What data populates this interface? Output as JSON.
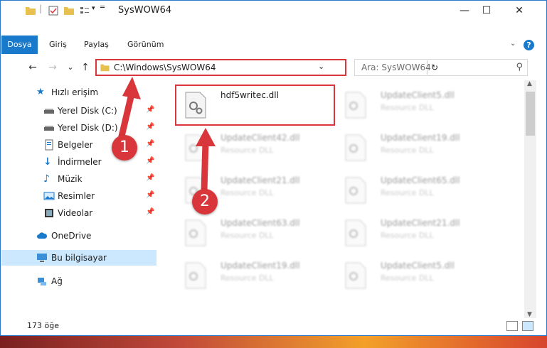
{
  "window": {
    "title": "SysWOW64",
    "minimize": "—",
    "maximize": "☐",
    "close": "✕"
  },
  "ribbon": {
    "tabs": [
      "Dosya",
      "Giriş",
      "Paylaş",
      "Görünüm"
    ],
    "help": "?"
  },
  "nav": {
    "back": "←",
    "forward": "→",
    "recent": "⌄",
    "up": "↑",
    "address": "C:\\Windows\\SysWOW64",
    "refresh": "↻",
    "dropdown": "⌄"
  },
  "search": {
    "placeholder": "Ara: SysWOW64",
    "icon": "search-icon"
  },
  "sidebar": {
    "items": [
      {
        "label": "Hızlı erişim",
        "icon": "star-icon"
      },
      {
        "label": "Yerel Disk (C:)",
        "icon": "drive-icon",
        "pinned": true
      },
      {
        "label": "Yerel Disk (D:)",
        "icon": "drive-icon",
        "pinned": true
      },
      {
        "label": "Belgeler",
        "icon": "documents-icon",
        "pinned": true
      },
      {
        "label": "İndirmeler",
        "icon": "download-icon",
        "pinned": true
      },
      {
        "label": "Müzik",
        "icon": "music-icon",
        "pinned": true
      },
      {
        "label": "Resimler",
        "icon": "pictures-icon",
        "pinned": true
      },
      {
        "label": "Videolar",
        "icon": "videos-icon",
        "pinned": true
      },
      {
        "label": "OneDrive",
        "icon": "cloud-icon"
      },
      {
        "label": "Bu bilgisayar",
        "icon": "computer-icon"
      },
      {
        "label": "Ağ",
        "icon": "network-icon"
      }
    ]
  },
  "files": [
    {
      "name": "hdf5writec.dll",
      "type": ""
    },
    {
      "name": "UpdateClient5.dll",
      "type": "Resource DLL"
    },
    {
      "name": "UpdateClient42.dll",
      "type": "Resource DLL"
    },
    {
      "name": "UpdateClient19.dll",
      "type": "Resource DLL"
    },
    {
      "name": "UpdateClient21.dll",
      "type": "Resource DLL"
    },
    {
      "name": "UpdateClient65.dll",
      "type": "Resource DLL"
    },
    {
      "name": "UpdateClient63.dll",
      "type": "Resource DLL"
    },
    {
      "name": "UpdateClient21.dll",
      "type": "Resource DLL"
    },
    {
      "name": "UpdateClient19.dll",
      "type": "Resource DLL"
    },
    {
      "name": "UpdateClient5.dll",
      "type": "Resource DLL"
    }
  ],
  "status": {
    "count": "173 öğe"
  },
  "callouts": [
    "1",
    "2"
  ],
  "colors": {
    "accent": "#1979ca",
    "highlight": "#d9363b",
    "selected": "#cce8ff"
  }
}
